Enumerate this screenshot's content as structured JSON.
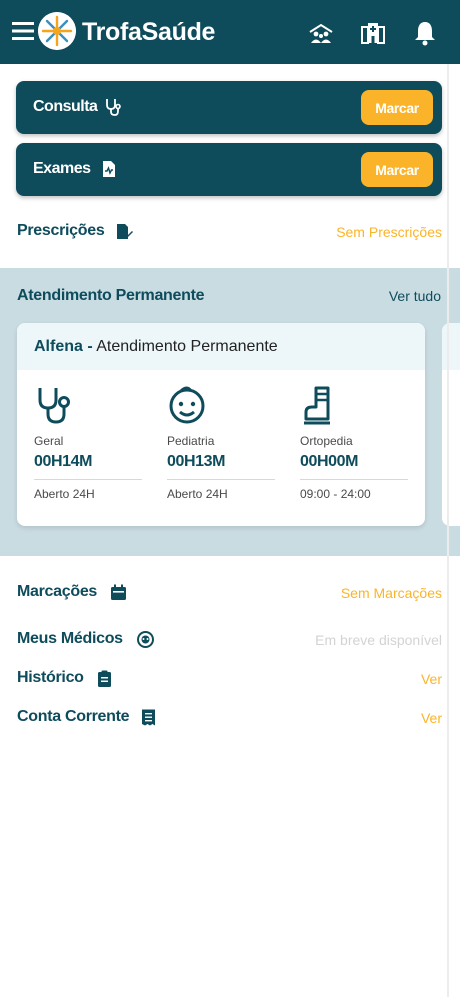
{
  "colors": {
    "primary": "#0e4c5c",
    "accent": "#fbb429",
    "section_bg": "#c9dce2",
    "muted": "#d3d3d3"
  },
  "header": {
    "brand": "TrofaSaúde",
    "icons": [
      "menu-icon",
      "trofa-logo-icon",
      "family-icon",
      "hospital-icon",
      "bell-icon"
    ]
  },
  "actions": {
    "consulta": {
      "label": "Consulta",
      "icon": "stethoscope-icon",
      "button": "Marcar"
    },
    "exames": {
      "label": "Exames",
      "icon": "document-icon",
      "button": "Marcar"
    }
  },
  "prescricoes": {
    "label": "Prescrições",
    "icon": "prescription-icon",
    "value": "Sem Prescrições"
  },
  "atendimento": {
    "title": "Atendimento Permanente",
    "link": "Ver tudo",
    "card": {
      "location": "Alfena -",
      "name": "Atendimento Permanente",
      "specialties": [
        {
          "icon": "stethoscope-icon",
          "name": "Geral",
          "wait": "00H14M",
          "hours": "Aberto 24H"
        },
        {
          "icon": "baby-icon",
          "name": "Pediatria",
          "wait": "00H13M",
          "hours": "Aberto 24H"
        },
        {
          "icon": "boot-cast-icon",
          "name": "Ortopedia",
          "wait": "00H00M",
          "hours": "09:00 - 24:00"
        }
      ]
    }
  },
  "menu": [
    {
      "label": "Marcações",
      "icon": "calendar-icon",
      "value": "Sem Marcações"
    },
    {
      "label": "Meus Médicos",
      "icon": "doctor-icon",
      "value": "Em breve disponível"
    },
    {
      "label": "Histórico",
      "icon": "clipboard-icon",
      "value": "Ver"
    },
    {
      "label": "Conta Corrente",
      "icon": "receipt-icon",
      "value": "Ver"
    }
  ]
}
